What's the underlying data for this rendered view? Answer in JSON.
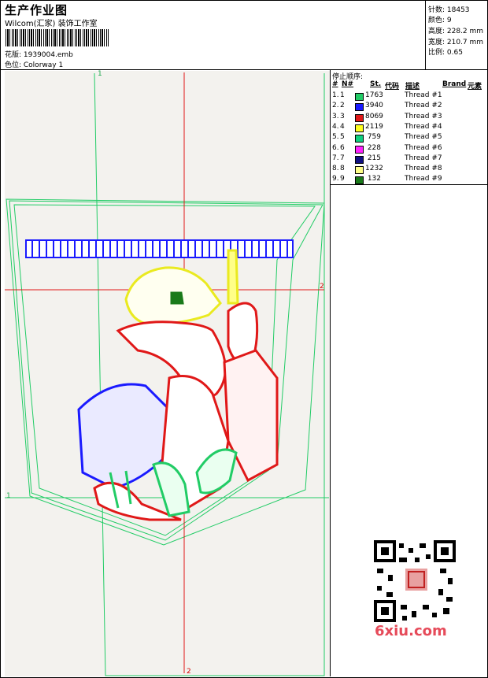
{
  "header": {
    "title": "生产作业图",
    "studio": "Wilcom(汇家) 装饰工作室",
    "pattern_label": "花版: 1939004.emb",
    "colorway_label": "色位: Colorway 1"
  },
  "stats": {
    "stitches": "针数: 18453",
    "colors": "颜色: 9",
    "height": "高度: 228.2 mm",
    "width": "宽度: 210.7 mm",
    "scale": "比例: 0.65"
  },
  "stop_sequence": {
    "title": "停止顺序:",
    "headers": {
      "num": "#",
      "needle": "N#",
      "st": "St.",
      "code": "代码",
      "desc": "描述",
      "brand": "Brand",
      "element": "元素"
    },
    "rows": [
      {
        "num": "1.",
        "needle": "1",
        "color": "#22cc66",
        "stitches": "1763",
        "desc": "Thread #1"
      },
      {
        "num": "2.",
        "needle": "2",
        "color": "#1a1aff",
        "stitches": "3940",
        "desc": "Thread #2"
      },
      {
        "num": "3.",
        "needle": "3",
        "color": "#e01818",
        "stitches": "8069",
        "desc": "Thread #3"
      },
      {
        "num": "4.",
        "needle": "4",
        "color": "#ffff20",
        "stitches": "2119",
        "desc": "Thread #4"
      },
      {
        "num": "5.",
        "needle": "5",
        "color": "#10d080",
        "stitches": "759",
        "desc": "Thread #5"
      },
      {
        "num": "6.",
        "needle": "6",
        "color": "#ff22ff",
        "stitches": "228",
        "desc": "Thread #6"
      },
      {
        "num": "7.",
        "needle": "7",
        "color": "#101080",
        "stitches": "215",
        "desc": "Thread #7"
      },
      {
        "num": "8.",
        "needle": "8",
        "color": "#ffff88",
        "stitches": "1232",
        "desc": "Thread #8"
      },
      {
        "num": "9.",
        "needle": "9",
        "color": "#1a7a1a",
        "stitches": "132",
        "desc": "Thread #9"
      }
    ]
  },
  "axes": {
    "top_green": "1",
    "left_green": "1",
    "right_red": "2",
    "bottom_red": "2"
  },
  "watermark": {
    "text": "6xiu.com"
  }
}
